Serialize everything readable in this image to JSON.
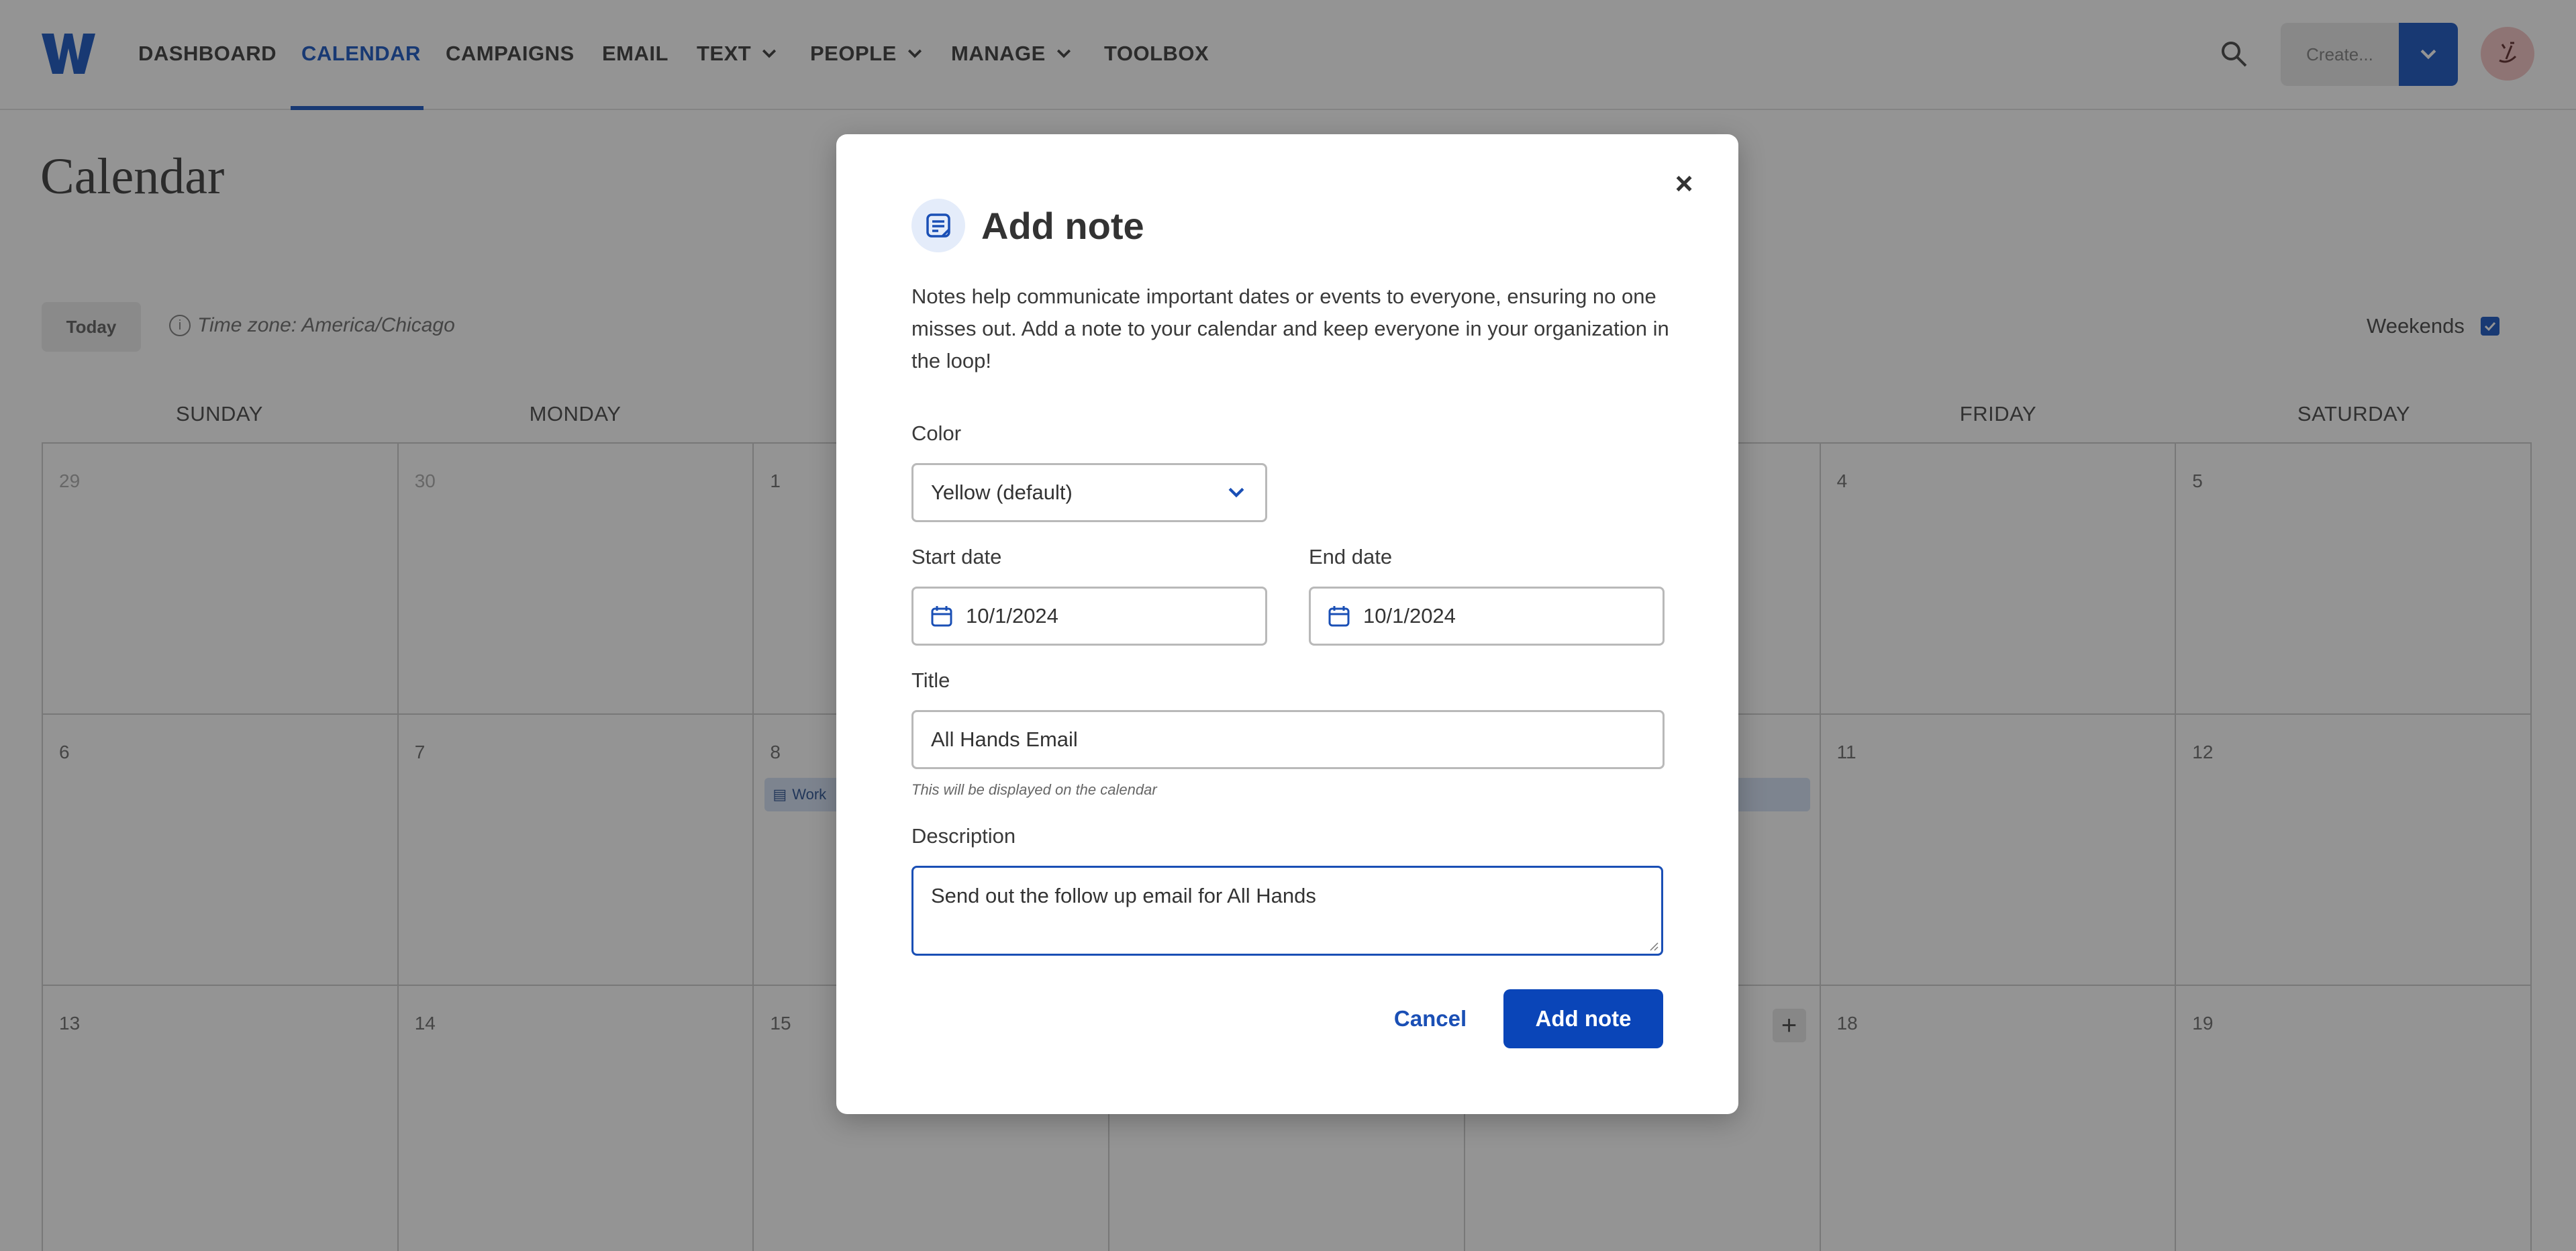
{
  "nav": {
    "logo_text": "W",
    "items": [
      {
        "label": "DASHBOARD",
        "dropdown": false,
        "active": false
      },
      {
        "label": "CALENDAR",
        "dropdown": false,
        "active": true
      },
      {
        "label": "CAMPAIGNS",
        "dropdown": false,
        "active": false
      },
      {
        "label": "EMAIL",
        "dropdown": false,
        "active": false
      },
      {
        "label": "TEXT",
        "dropdown": true,
        "active": false
      },
      {
        "label": "PEOPLE",
        "dropdown": true,
        "active": false
      },
      {
        "label": "MANAGE",
        "dropdown": true,
        "active": false
      },
      {
        "label": "TOOLBOX",
        "dropdown": false,
        "active": false
      }
    ],
    "create_label": "Create..."
  },
  "page": {
    "title": "Calendar",
    "today_label": "Today",
    "timezone": "Time zone: America/Chicago",
    "weekends_label": "Weekends",
    "weekends_checked": true
  },
  "calendar": {
    "weekdays": [
      "SUNDAY",
      "MONDAY",
      "",
      "",
      "",
      "FRIDAY",
      "SATURDAY"
    ],
    "weeks": [
      [
        {
          "n": "29",
          "muted": true
        },
        {
          "n": "30",
          "muted": true
        },
        {
          "n": "1"
        },
        {
          "n": ""
        },
        {
          "n": ""
        },
        {
          "n": "4"
        },
        {
          "n": "5"
        }
      ],
      [
        {
          "n": "6"
        },
        {
          "n": "7"
        },
        {
          "n": "8",
          "chip": "Work"
        },
        {
          "n": ""
        },
        {
          "n": ""
        },
        {
          "n": "11"
        },
        {
          "n": "12"
        }
      ],
      [
        {
          "n": "13"
        },
        {
          "n": "14"
        },
        {
          "n": "15"
        },
        {
          "n": ""
        },
        {
          "n": ""
        },
        {
          "n": "18"
        },
        {
          "n": "19"
        }
      ]
    ]
  },
  "modal": {
    "title": "Add note",
    "description": "Notes help communicate important dates or events to everyone, ensuring no one misses out. Add a note to your calendar and keep everyone in your organization in the loop!",
    "color_label": "Color",
    "color_value": "Yellow (default)",
    "start_label": "Start date",
    "start_value": "10/1/2024",
    "end_label": "End date",
    "end_value": "10/1/2024",
    "title_label": "Title",
    "title_value": "All Hands Email",
    "title_hint": "This will be displayed on the calendar",
    "desc_label": "Description",
    "desc_value": "Send out the follow up email for All Hands",
    "cancel_label": "Cancel",
    "submit_label": "Add note"
  },
  "colors": {
    "accent": "#2a63c7",
    "primary_button": "#0a45b8",
    "overlay": "rgba(0,0,0,0.42)"
  },
  "icons": {
    "search": "search-icon",
    "chevron": "chevron-down-icon",
    "note": "note-icon",
    "calendar": "calendar-icon",
    "close": "close-icon",
    "info": "info-icon",
    "plus": "plus-icon"
  }
}
